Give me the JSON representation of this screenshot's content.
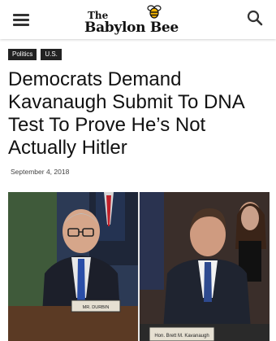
{
  "header": {
    "menu_icon": "hamburger-menu-icon",
    "logo": {
      "line1": "The",
      "line2": "Babylon Bee",
      "icon": "bee-icon"
    },
    "search_icon": "search-icon"
  },
  "article": {
    "tags": [
      "Politics",
      "U.S."
    ],
    "headline": "Democrats Demand Kavanaugh Submit To DNA Test To Prove He’s Not Actually Hitler",
    "date": "September 4, 2018",
    "image": {
      "left_nameplate": "MR. DURBIN",
      "right_nameplate": "Hon. Brett M. Kavanaugh"
    }
  }
}
